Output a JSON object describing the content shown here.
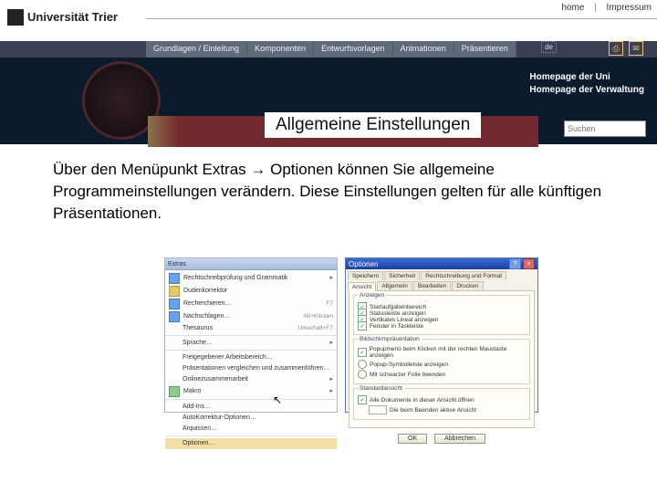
{
  "topbar": {
    "home": "home",
    "impressum": "Impressum"
  },
  "logo": {
    "text": "Universität Trier"
  },
  "nav": {
    "items": [
      "Grundlagen / Einleitung",
      "Komponenten",
      "Entwurfsvorlagen",
      "Animationen",
      "Präsentieren"
    ],
    "lang": "de"
  },
  "homepage_links": {
    "line1": "Homepage der Uni",
    "line2": "Homepage der Verwaltung"
  },
  "strip": {
    "title": "Allgemeine Einstellungen"
  },
  "search": {
    "placeholder": "Suchen"
  },
  "body": {
    "text": "Über den Menüpunkt Extras → Optionen können Sie allgemeine Programmeinstellungen verändern. Diese Einstellungen gelten für alle künftigen Präsentationen."
  },
  "extras": {
    "title": "Extras",
    "items": [
      {
        "label": "Rechtschreibprüfung und Grammatik",
        "accel": "",
        "arrow": "▸"
      },
      {
        "label": "Dudenkorrektor",
        "accel": ""
      },
      {
        "label": "Recherchieren…",
        "accel": "F7"
      },
      {
        "label": "Nachschlagen…",
        "accel": "Alt+Klicken"
      },
      {
        "label": "Thesaurus",
        "accel": "Umschalt+F7"
      },
      {
        "label": "Sprache…",
        "accel": "",
        "arrow": "▸"
      },
      {
        "label": "Freigegebener Arbeitsbereich…",
        "accel": ""
      },
      {
        "label": "Präsentationen vergleichen und zusammenführen…",
        "accel": ""
      },
      {
        "label": "Onlinezusammenarbeit",
        "accel": "",
        "arrow": "▸"
      },
      {
        "label": "Makro",
        "accel": "",
        "arrow": "▸"
      },
      {
        "label": "Add-Ins…",
        "accel": ""
      },
      {
        "label": "AutoKorrektur-Optionen…",
        "accel": ""
      },
      {
        "label": "Anpassen…",
        "accel": ""
      },
      {
        "label": "Optionen…",
        "accel": ""
      }
    ]
  },
  "options": {
    "title": "Optionen",
    "tabs_row1": [
      "Speichern",
      "Sicherheit",
      "Rechtschreibung und Format"
    ],
    "tabs_row2": [
      "Ansicht",
      "Allgemein",
      "Bearbeiten",
      "Drucken"
    ],
    "active_tab": "Ansicht",
    "group1": {
      "title": "Anzeigen",
      "one": "Startaufgabenbereich",
      "two": "Statusleiste anzeigen",
      "three": "Vertikales Lineal anzeigen",
      "four": "Fenster in Taskleiste"
    },
    "group2": {
      "title": "Bildschirmpräsentation",
      "one": "Popupmenü beim Klicken mit der rechten Maustaste anzeigen",
      "two": "Popup-Symbolleiste anzeigen",
      "three": "Mit schwarzer Folie beenden"
    },
    "group3": {
      "title": "Standardansicht",
      "label": "Alle Dokumente in dieser Ansicht öffnen",
      "dd": "Die beim Beenden aktive Ansicht"
    },
    "buttons": {
      "ok": "OK",
      "cancel": "Abbrechen"
    }
  }
}
